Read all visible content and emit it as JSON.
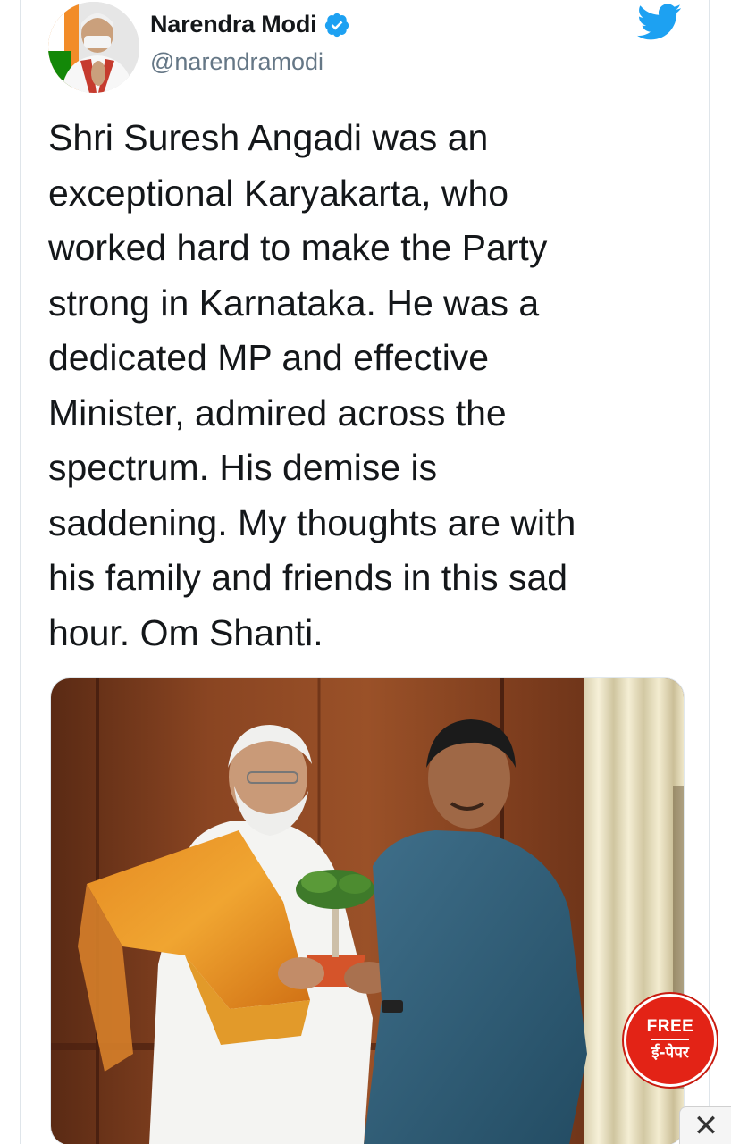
{
  "tweet": {
    "author_name": "Narendra Modi",
    "handle": "@narendramodi",
    "text": "Shri Suresh Angadi was an\nexceptional Karyakarta, who\nworked hard to make the Party\nstrong in Karnataka. He was a\ndedicated MP and effective\nMinister, admired across the\nspectrum. His demise is\nsaddening. My thoughts are with\nhis family and friends in this sad\nhour. Om Shanti."
  },
  "icons": {
    "verified": "verified-badge-icon",
    "platform": "twitter-bird-icon",
    "close": "close-icon"
  },
  "badge": {
    "line1": "FREE",
    "line2": "ई-पेपर"
  },
  "close_button": {
    "label": "✕"
  },
  "colors": {
    "twitter_blue": "#1da1f2",
    "text_primary": "#14171a",
    "text_secondary": "#657786",
    "badge_red": "#e32316"
  }
}
